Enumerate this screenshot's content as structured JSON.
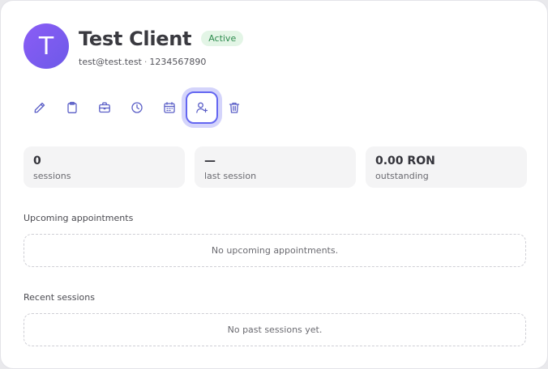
{
  "client": {
    "initial": "T",
    "name": "Test Client",
    "status": "Active",
    "email": "test@test.test",
    "separator": "·",
    "phone": "1234567890"
  },
  "toolbar": {
    "actions": [
      {
        "icon": "pencil-icon"
      },
      {
        "icon": "clipboard-icon"
      },
      {
        "icon": "briefcase-icon"
      },
      {
        "icon": "clock-icon"
      },
      {
        "icon": "calendar-icon"
      },
      {
        "icon": "user-plus-icon",
        "selected": true
      },
      {
        "icon": "trash-icon"
      }
    ]
  },
  "stats": [
    {
      "value": "0",
      "label": "sessions"
    },
    {
      "value": "—",
      "label": "last session"
    },
    {
      "value": "0.00 RON",
      "label": "outstanding"
    }
  ],
  "upcoming": {
    "title": "Upcoming appointments",
    "empty": "No upcoming appointments."
  },
  "recent": {
    "title": "Recent sessions",
    "empty": "No past sessions yet."
  },
  "colors": {
    "accent": "#6366f1",
    "icon": "#5b5fc7",
    "active_badge_bg": "#e3f5e6",
    "active_badge_text": "#2e8b4e"
  }
}
